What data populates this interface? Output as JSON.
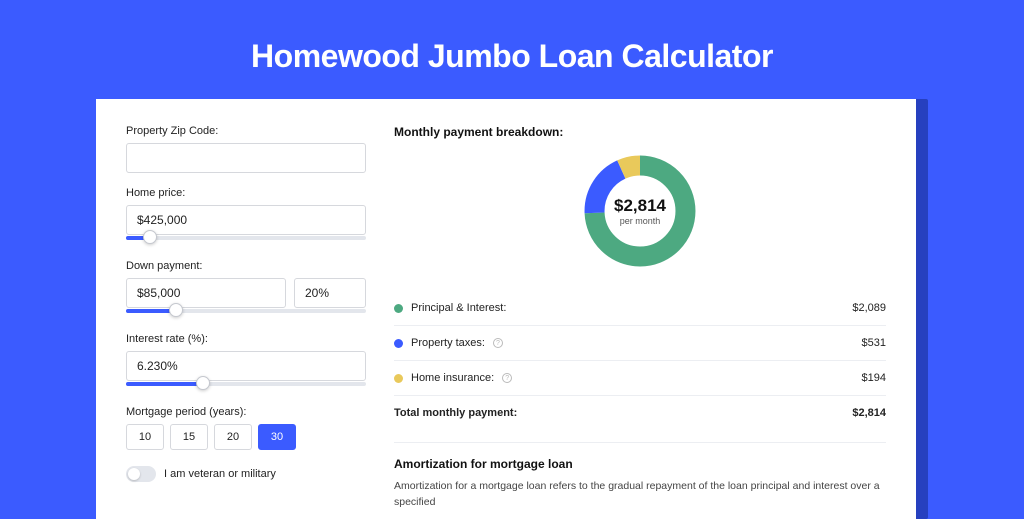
{
  "page_title": "Homewood Jumbo Loan Calculator",
  "colors": {
    "accent": "#3b5bff",
    "green": "#4da981",
    "yellow": "#e9c95b"
  },
  "form": {
    "zip": {
      "label": "Property Zip Code:",
      "value": ""
    },
    "home_price": {
      "label": "Home price:",
      "value": "$425,000",
      "slider_pct": 10
    },
    "down_payment": {
      "label": "Down payment:",
      "value": "$85,000",
      "pct_value": "20%",
      "slider_pct": 21
    },
    "interest_rate": {
      "label": "Interest rate (%):",
      "value": "6.230%",
      "slider_pct": 32
    },
    "mortgage_period": {
      "label": "Mortgage period (years):",
      "options": [
        "10",
        "15",
        "20",
        "30"
      ],
      "selected": "30"
    },
    "veteran": {
      "label": "I am veteran or military",
      "checked": false
    }
  },
  "breakdown": {
    "title": "Monthly payment breakdown:",
    "center_value": "$2,814",
    "center_label": "per month",
    "items": [
      {
        "label": "Principal & Interest:",
        "value": "$2,089",
        "color": "green",
        "numeric": 2089
      },
      {
        "label": "Property taxes:",
        "value": "$531",
        "color": "blue",
        "numeric": 531,
        "info": true
      },
      {
        "label": "Home insurance:",
        "value": "$194",
        "color": "yellow",
        "numeric": 194,
        "info": true
      }
    ],
    "total_label": "Total monthly payment:",
    "total_value": "$2,814"
  },
  "amortization": {
    "title": "Amortization for mortgage loan",
    "text": "Amortization for a mortgage loan refers to the gradual repayment of the loan principal and interest over a specified"
  },
  "chart_data": {
    "type": "pie",
    "title": "Monthly payment breakdown",
    "series": [
      {
        "name": "Principal & Interest",
        "value": 2089,
        "color": "#4da981"
      },
      {
        "name": "Property taxes",
        "value": 531,
        "color": "#3b5bff"
      },
      {
        "name": "Home insurance",
        "value": 194,
        "color": "#e9c95b"
      }
    ],
    "total": 2814,
    "center_label": "$2,814 per month"
  }
}
